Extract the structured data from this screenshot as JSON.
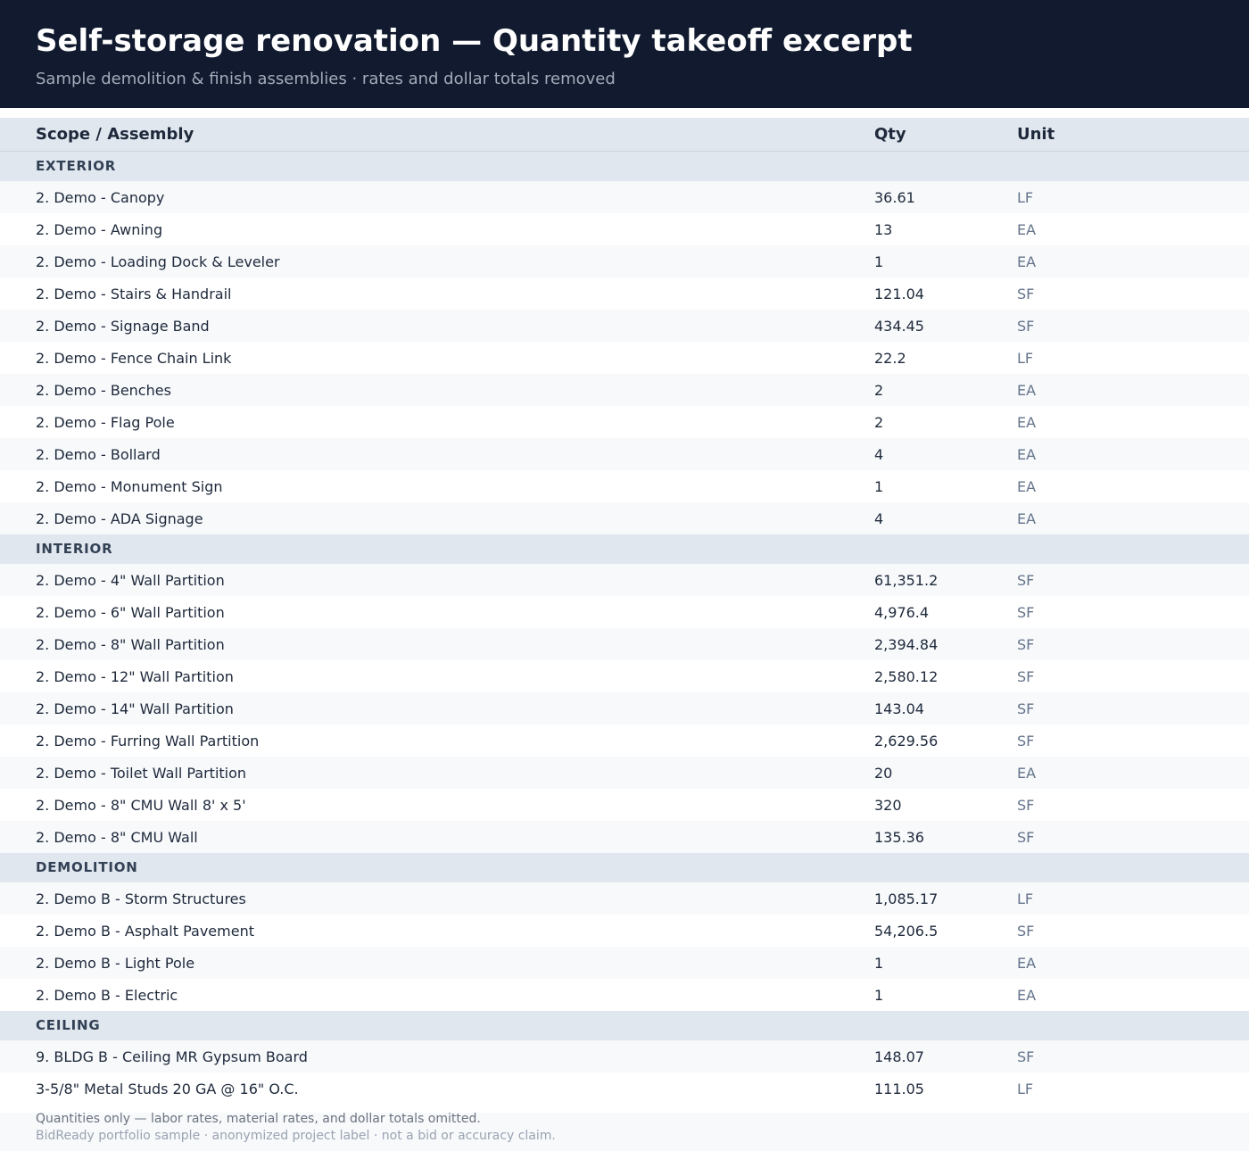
{
  "header": {
    "title": "Self-storage renovation — Quantity takeoff excerpt",
    "subtitle": "Sample demolition & finish assemblies · rates and dollar totals removed"
  },
  "table": {
    "columns": {
      "scope": "Scope / Assembly",
      "qty": "Qty",
      "unit": "Unit"
    },
    "sections": [
      {
        "label": "EXTERIOR",
        "rows": [
          {
            "name": "2. Demo - Canopy",
            "qty": "36.61",
            "unit": "LF"
          },
          {
            "name": "2. Demo - Awning",
            "qty": "13",
            "unit": "EA"
          },
          {
            "name": "2. Demo - Loading Dock & Leveler",
            "qty": "1",
            "unit": "EA"
          },
          {
            "name": "2. Demo - Stairs & Handrail",
            "qty": "121.04",
            "unit": "SF"
          },
          {
            "name": "2. Demo - Signage Band",
            "qty": "434.45",
            "unit": "SF"
          },
          {
            "name": "2. Demo - Fence Chain Link",
            "qty": "22.2",
            "unit": "LF"
          },
          {
            "name": "2. Demo - Benches",
            "qty": "2",
            "unit": "EA"
          },
          {
            "name": "2. Demo - Flag Pole",
            "qty": "2",
            "unit": "EA"
          },
          {
            "name": "2. Demo - Bollard",
            "qty": "4",
            "unit": "EA"
          },
          {
            "name": "2. Demo - Monument Sign",
            "qty": "1",
            "unit": "EA"
          },
          {
            "name": "2. Demo - ADA Signage",
            "qty": "4",
            "unit": "EA"
          }
        ]
      },
      {
        "label": "INTERIOR",
        "rows": [
          {
            "name": "2. Demo - 4\" Wall Partition",
            "qty": "61,351.2",
            "unit": "SF"
          },
          {
            "name": "2. Demo - 6\" Wall Partition",
            "qty": "4,976.4",
            "unit": "SF"
          },
          {
            "name": "2. Demo - 8\" Wall Partition",
            "qty": "2,394.84",
            "unit": "SF"
          },
          {
            "name": "2. Demo - 12\" Wall Partition",
            "qty": "2,580.12",
            "unit": "SF"
          },
          {
            "name": "2. Demo - 14\" Wall Partition",
            "qty": "143.04",
            "unit": "SF"
          },
          {
            "name": "2. Demo - Furring Wall Partition",
            "qty": "2,629.56",
            "unit": "SF"
          },
          {
            "name": "2. Demo - Toilet Wall Partition",
            "qty": "20",
            "unit": "EA"
          },
          {
            "name": "2. Demo - 8\" CMU Wall 8' x 5'",
            "qty": "320",
            "unit": "SF"
          },
          {
            "name": "2. Demo - 8\" CMU Wall",
            "qty": "135.36",
            "unit": "SF"
          }
        ]
      },
      {
        "label": "DEMOLITION",
        "rows": [
          {
            "name": "2. Demo B - Storm Structures",
            "qty": "1,085.17",
            "unit": "LF"
          },
          {
            "name": "2. Demo B - Asphalt Pavement",
            "qty": "54,206.5",
            "unit": "SF"
          },
          {
            "name": "2. Demo B - Light Pole",
            "qty": "1",
            "unit": "EA"
          },
          {
            "name": "2. Demo B - Electric",
            "qty": "1",
            "unit": "EA"
          }
        ]
      },
      {
        "label": "CEILING",
        "rows": [
          {
            "name": "9. BLDG B - Ceiling MR Gypsum Board",
            "qty": "148.07",
            "unit": "SF"
          },
          {
            "name": "3-5/8\" Metal Studs 20 GA @ 16\" O.C.",
            "qty": "111.05",
            "unit": "LF"
          }
        ]
      }
    ]
  },
  "footer": {
    "note": "Quantities only — labor rates, material rates, and dollar totals omitted.",
    "disclaimer": "BidReady portfolio sample · anonymized project label · not a bid or accuracy claim."
  }
}
